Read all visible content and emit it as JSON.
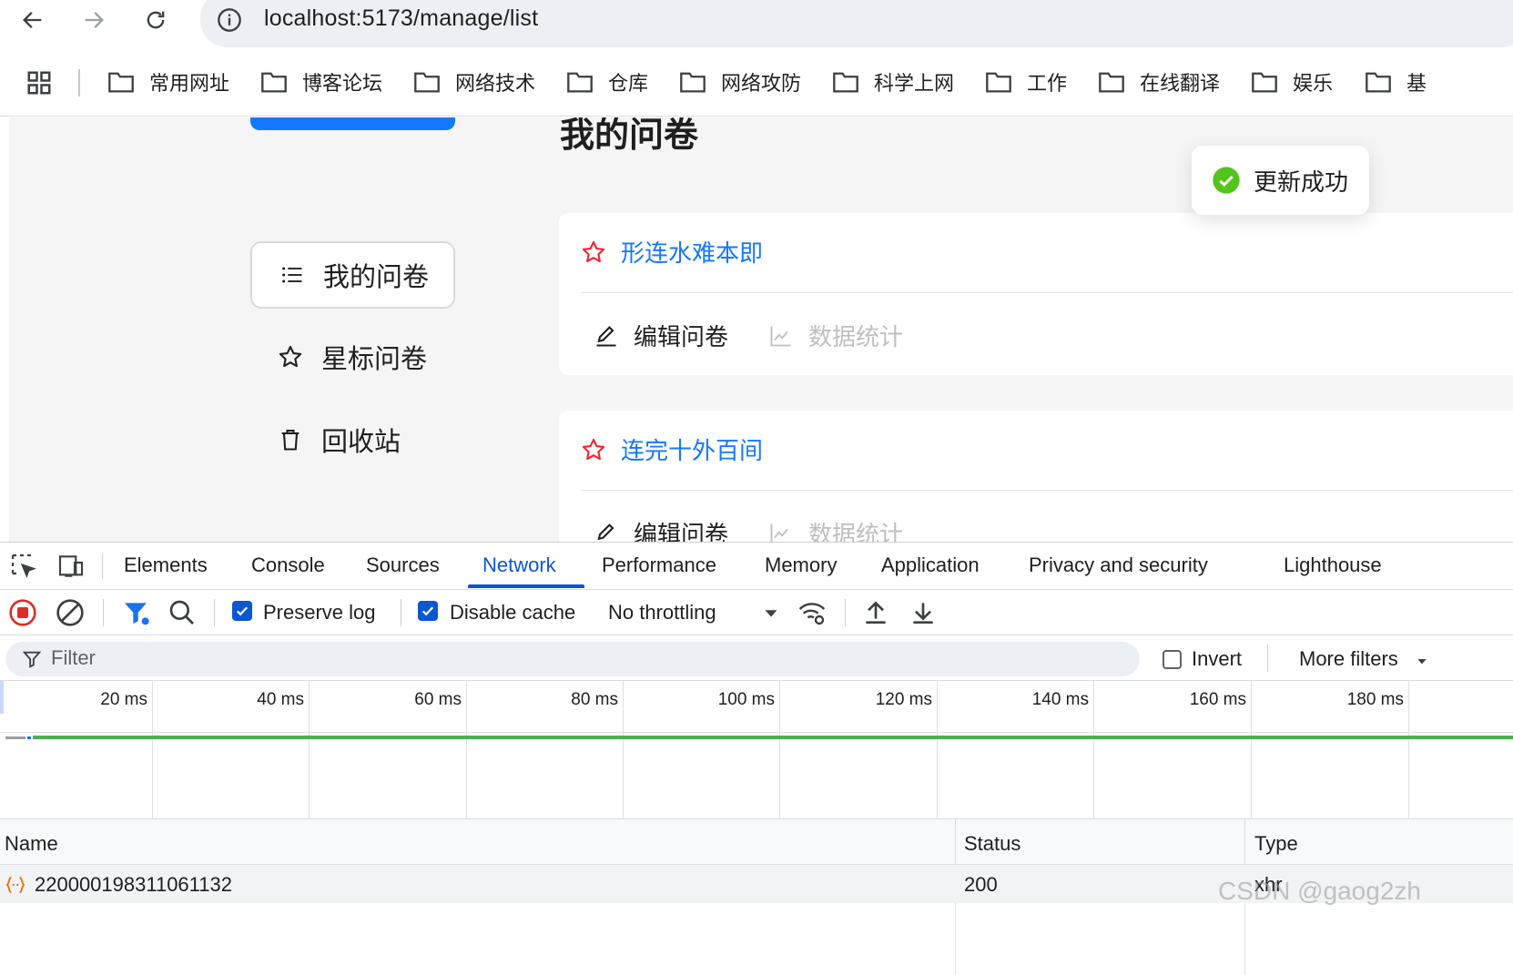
{
  "browser": {
    "url": "localhost:5173/manage/list",
    "bookmarks": [
      "常用网址",
      "博客论坛",
      "网络技术",
      "仓库",
      "网络攻防",
      "科学上网",
      "工作",
      "在线翻译",
      "娱乐",
      "基"
    ]
  },
  "page": {
    "title": "我的问卷",
    "sidebar": {
      "items": [
        {
          "label": "我的问卷",
          "icon": "list-icon",
          "active": true
        },
        {
          "label": "星标问卷",
          "icon": "star-icon",
          "active": false
        },
        {
          "label": "回收站",
          "icon": "trash-icon",
          "active": false
        }
      ]
    },
    "toast": {
      "text": "更新成功",
      "icon": "check-circle-icon",
      "color": "#52c41a"
    },
    "cards": [
      {
        "title": "形连水难本即",
        "edit_label": "编辑问卷",
        "stats_label": "数据统计"
      },
      {
        "title": "连完十外百间",
        "edit_label": "编辑问卷",
        "stats_label": "数据统计"
      }
    ],
    "colors": {
      "primary": "#1677ff",
      "star": "#f5222d",
      "disabled": "#bfbfbf"
    }
  },
  "devtools": {
    "tabs": [
      {
        "label": "Elements"
      },
      {
        "label": "Console"
      },
      {
        "label": "Sources"
      },
      {
        "label": "Network",
        "active": true
      },
      {
        "label": "Performance"
      },
      {
        "label": "Memory"
      },
      {
        "label": "Application"
      },
      {
        "label": "Privacy and security"
      },
      {
        "label": "Lighthouse"
      }
    ],
    "toolbar": {
      "preserve_log": {
        "label": "Preserve log",
        "checked": true
      },
      "disable_cache": {
        "label": "Disable cache",
        "checked": true
      },
      "throttling": "No throttling"
    },
    "filter": {
      "placeholder": "Filter",
      "invert_label": "Invert",
      "invert_checked": false,
      "more_filters": "More filters"
    },
    "timeline": {
      "ticks": [
        "20 ms",
        "40 ms",
        "60 ms",
        "80 ms",
        "100 ms",
        "120 ms",
        "140 ms",
        "160 ms",
        "180 ms"
      ]
    },
    "table": {
      "columns": [
        "Name",
        "Status",
        "Type"
      ],
      "rows": [
        {
          "name": "220000198311061132",
          "status": "200",
          "type": "xhr"
        }
      ]
    }
  },
  "watermark": "CSDN @gaog2zh"
}
